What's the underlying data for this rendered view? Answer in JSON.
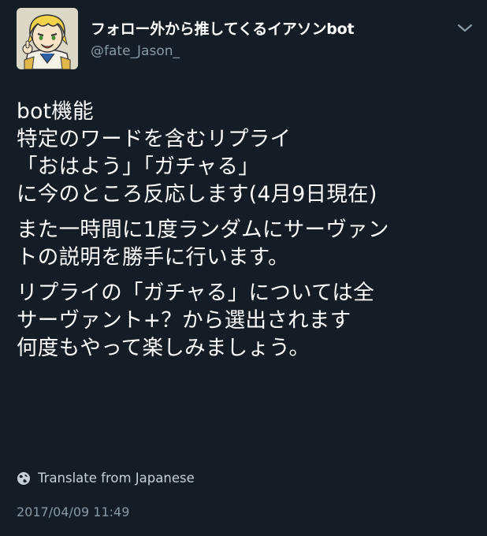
{
  "author": {
    "display_name": "フォロー外から推してくるイアソンbot",
    "handle": "@fate_Jason_",
    "avatar_icon": "cartoon-character-avatar"
  },
  "menu": {
    "icon": "chevron-down-icon"
  },
  "tweet": {
    "paragraphs": [
      "bot機能\n特定のワードを含むリプライ\n「おはよう」「ガチャる」\nに今のところ反応します(4月9日現在)",
      "また一時間に1度ランダムにサーヴァン\nトの説明を勝手に行います。",
      "リプライの「ガチャる」については全\nサーヴァント+？から選出されます\n何度もやって楽しみましょう。"
    ]
  },
  "translate": {
    "label": "Translate from Japanese",
    "icon": "globe-icon"
  },
  "timestamp": "2017/04/09 11:49",
  "colors": {
    "background": "#141d26",
    "text": "#ffffff",
    "secondary_text": "#8899a6"
  }
}
